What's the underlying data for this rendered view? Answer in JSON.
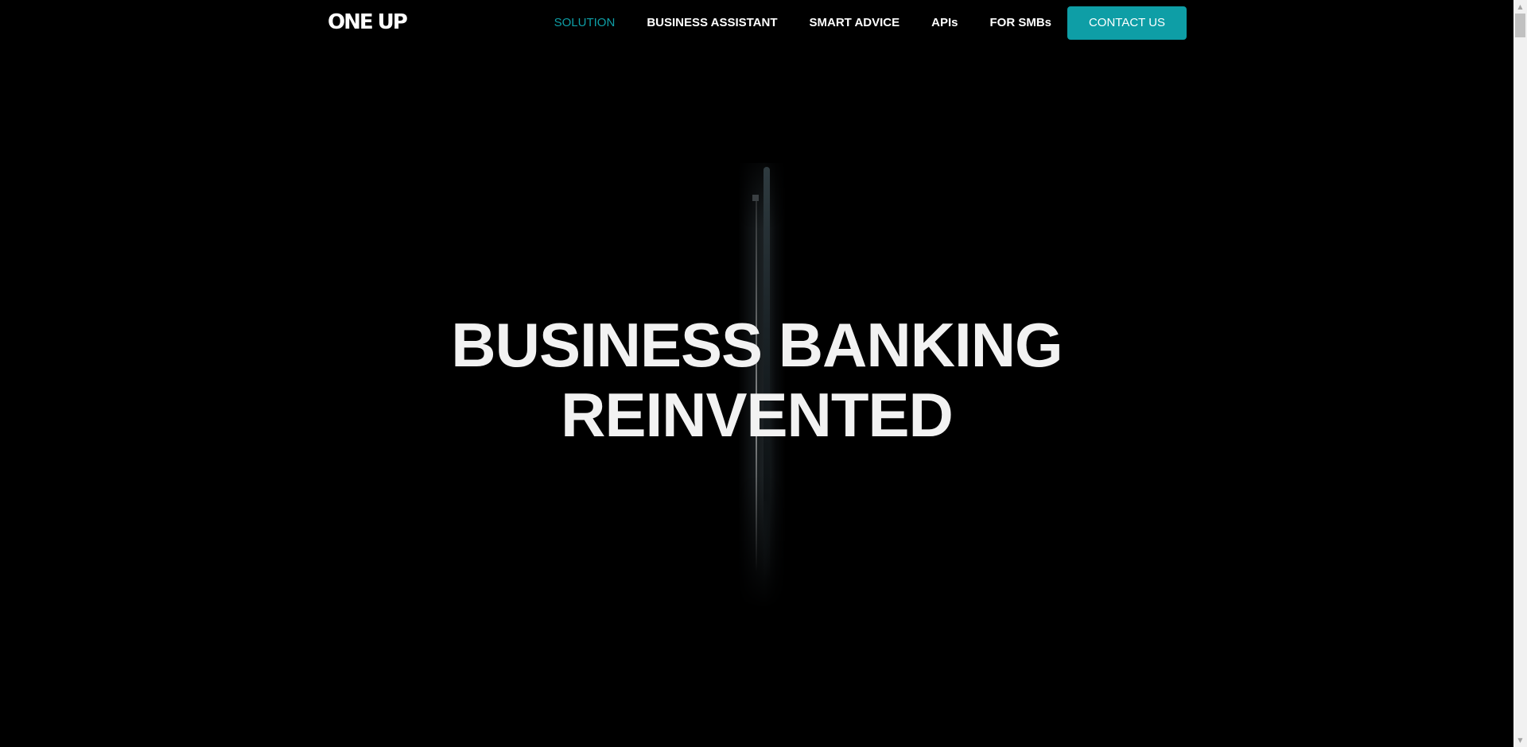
{
  "brand": {
    "logo_text": "ONE UP"
  },
  "nav": {
    "items": [
      {
        "label": "SOLUTION",
        "active": true
      },
      {
        "label": "BUSINESS ASSISTANT",
        "active": false
      },
      {
        "label": "SMART ADVICE",
        "active": false
      },
      {
        "label": "APIs",
        "active": false
      },
      {
        "label": "FOR SMBs",
        "active": false
      }
    ],
    "contact_label": "CONTACT US"
  },
  "hero": {
    "title_line1": "BUSINESS BANKING",
    "title_line2": "REINVENTED"
  },
  "colors": {
    "background": "#000000",
    "accent": "#0e9ea6",
    "text": "#f2f2f2"
  },
  "icons": {
    "scroll_up": "triangle-up-icon",
    "scroll_down": "triangle-down-icon"
  }
}
